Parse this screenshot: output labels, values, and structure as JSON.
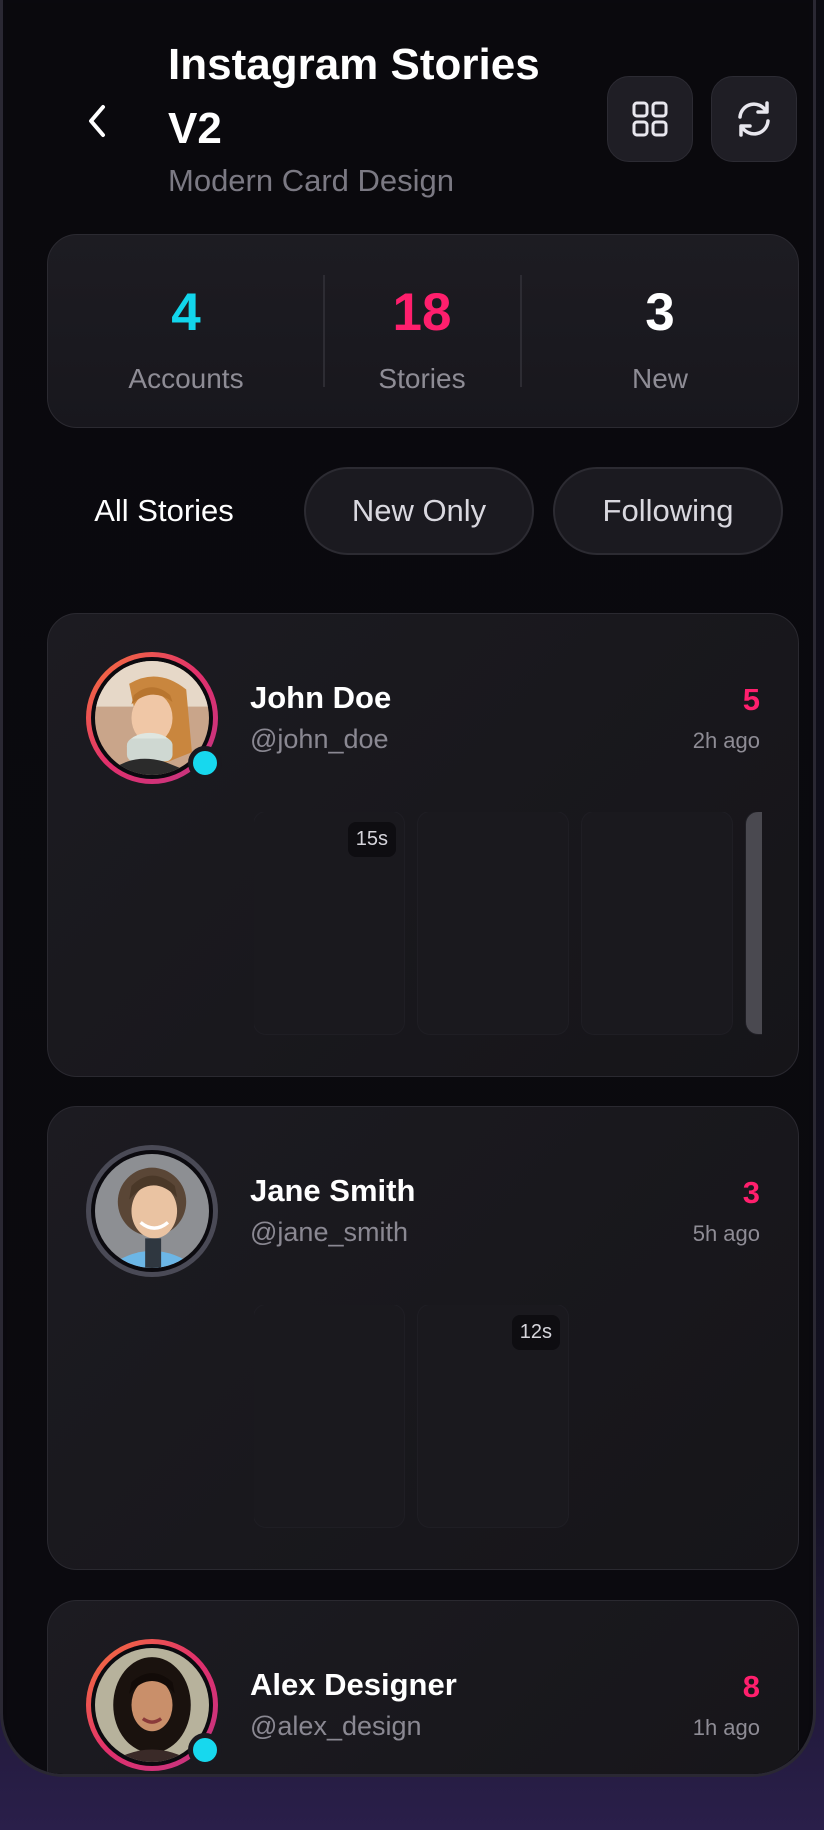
{
  "header": {
    "title": "Instagram Stories V2",
    "subtitle": "Modern Card Design",
    "back_icon": "chevron-left-icon",
    "grid_icon": "grid-icon",
    "refresh_icon": "refresh-icon"
  },
  "stats": [
    {
      "value": "4",
      "label": "Accounts",
      "color": "#12d6ec"
    },
    {
      "value": "18",
      "label": "Stories",
      "color": "#ff1f6d"
    },
    {
      "value": "3",
      "label": "New",
      "color": "#ffffff"
    }
  ],
  "filters": {
    "all": "All Stories",
    "new_only": "New Only",
    "following": "Following"
  },
  "cards": [
    {
      "name": "John Doe",
      "handle": "@john_doe",
      "count": "5",
      "time": "2h ago",
      "ring": "new",
      "online": true,
      "thumb_durations": [
        "15s",
        "",
        "",
        ""
      ]
    },
    {
      "name": "Jane Smith",
      "handle": "@jane_smith",
      "count": "3",
      "time": "5h ago",
      "ring": "seen",
      "online": false,
      "thumb_durations": [
        "",
        "12s"
      ]
    },
    {
      "name": "Alex Designer",
      "handle": "@alex_design",
      "count": "8",
      "time": "1h ago",
      "ring": "new",
      "online": true
    }
  ],
  "colors": {
    "accent_cyan": "#12d6ec",
    "accent_pink": "#ff1f6d",
    "background": "#0a090e",
    "card": "#1c1b21"
  }
}
